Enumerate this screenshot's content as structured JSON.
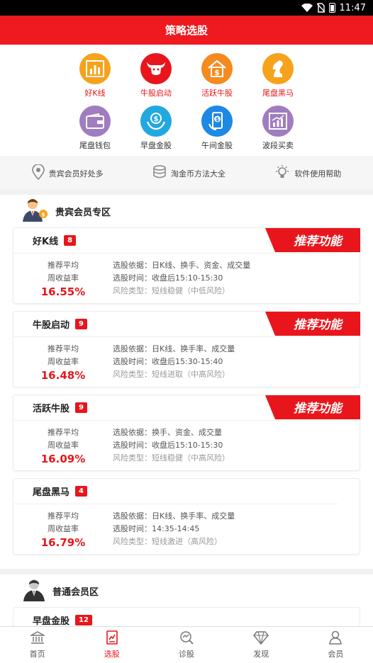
{
  "status": {
    "time": "11:47",
    "battery_text": "1"
  },
  "header": {
    "title": "策略选股"
  },
  "grid": [
    {
      "label": "好K线",
      "color": "#f7a21b",
      "icon": "bar-chart-icon",
      "active": true
    },
    {
      "label": "牛股启动",
      "color": "#e8161c",
      "icon": "bull-icon",
      "active": true
    },
    {
      "label": "活跃牛股",
      "color": "#f58a1f",
      "icon": "money-house-icon",
      "active": true
    },
    {
      "label": "尾盘黑马",
      "color": "#f7a21b",
      "icon": "chess-knight-icon",
      "active": true
    },
    {
      "label": "尾盘钱包",
      "color": "#a07cc0",
      "icon": "wallet-icon",
      "active": false
    },
    {
      "label": "早盘金股",
      "color": "#22a8e0",
      "icon": "hand-coin-icon",
      "active": false
    },
    {
      "label": "午间金股",
      "color": "#1e88e5",
      "icon": "phone-coin-icon",
      "active": false
    },
    {
      "label": "波段买卖",
      "color": "#a07cc0",
      "icon": "trend-chart-icon",
      "active": false
    }
  ],
  "quick_links": [
    {
      "label": "贵宾会员好处多",
      "icon": "location-pin-icon"
    },
    {
      "label": "淘金币方法大全",
      "icon": "coin-stack-icon"
    },
    {
      "label": "软件使用帮助",
      "icon": "lightbulb-icon"
    }
  ],
  "vip_section": {
    "title": "贵宾会员专区",
    "recommend_text": "推荐功能",
    "cards": [
      {
        "name": "好K线",
        "count": "8",
        "avg_label_1": "推荐平均",
        "avg_label_2": "周收益率",
        "pct": "16.55%",
        "basis": "选股依据：日K线、换手、资金、成交量",
        "time": "选股时间：收盘后15:10-15:30",
        "risk": "风险类型：短线稳健（中低风险）",
        "recommended": true
      },
      {
        "name": "牛股启动",
        "count": "9",
        "avg_label_1": "推荐平均",
        "avg_label_2": "周收益率",
        "pct": "16.48%",
        "basis": "选股依据：日K线、换手率、成交量",
        "time": "选股时间：收盘后15:30-15:40",
        "risk": "风险类型：短线进取（中高风险）",
        "recommended": true
      },
      {
        "name": "活跃牛股",
        "count": "9",
        "avg_label_1": "推荐平均",
        "avg_label_2": "周收益率",
        "pct": "16.09%",
        "basis": "选股依据：换手、资金、成交量",
        "time": "选股时间：收盘后15:10-15:30",
        "risk": "风险类型：短线稳健（中高风险）",
        "recommended": true
      },
      {
        "name": "尾盘黑马",
        "count": "4",
        "avg_label_1": "推荐平均",
        "avg_label_2": "周收益率",
        "pct": "16.79%",
        "basis": "选股依据：日K线、换手率、成交量",
        "time": "选股时间：14:35-14:45",
        "risk": "风险类型：短线激进（高风险）",
        "recommended": false
      }
    ]
  },
  "normal_section": {
    "title": "普通会员区",
    "cards": [
      {
        "name": "早盘金股",
        "count": "12"
      }
    ]
  },
  "tabs": [
    {
      "label": "首页",
      "icon": "bank-icon",
      "active": false
    },
    {
      "label": "选股",
      "icon": "stock-pick-icon",
      "active": true
    },
    {
      "label": "诊股",
      "icon": "diagnose-icon",
      "active": false
    },
    {
      "label": "发现",
      "icon": "diamond-icon",
      "active": false
    },
    {
      "label": "会员",
      "icon": "user-icon",
      "active": false
    }
  ],
  "colors": {
    "brand_red": "#ee1a1f",
    "accent_red": "#e8161c"
  }
}
